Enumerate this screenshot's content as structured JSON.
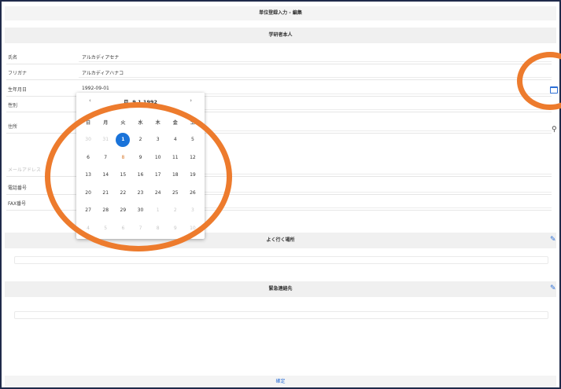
{
  "page": {
    "title": "単位登録入力 - 編集",
    "section_applicant": "学研者本人",
    "section_places": "よく行く場所",
    "section_contacts": "緊急連絡先",
    "footer_button": "確定"
  },
  "form": {
    "name_label": "氏名",
    "name_value": "アルカディアセナ",
    "kana_label": "フリガナ",
    "kana_value": "アルカディアハナコ",
    "birthday_label": "生年月日",
    "birthday_value": "1992-09-01",
    "gender_label": "性別",
    "address_label": "住所",
    "email_label": "メールアドレス",
    "phone_label": "電話番号",
    "fax_label": "FAX番号"
  },
  "calendar": {
    "header": "月, 9 1 1992",
    "prev": "‹",
    "next": "›",
    "weekdays": [
      "日",
      "月",
      "火",
      "水",
      "木",
      "金",
      "土"
    ],
    "weeks": [
      [
        "30",
        "31",
        "1",
        "2",
        "3",
        "4",
        "5"
      ],
      [
        "6",
        "7",
        "8",
        "9",
        "10",
        "11",
        "12"
      ],
      [
        "13",
        "14",
        "15",
        "16",
        "17",
        "18",
        "19"
      ],
      [
        "20",
        "21",
        "22",
        "23",
        "24",
        "25",
        "26"
      ],
      [
        "27",
        "28",
        "29",
        "30",
        "1",
        "2",
        "3"
      ],
      [
        "4",
        "5",
        "6",
        "7",
        "8",
        "9",
        "10"
      ]
    ],
    "selected_day": "1"
  },
  "colors": {
    "accent": "#1a73d9",
    "annotation": "#ed7b2d",
    "frame": "#1f2a4a"
  },
  "icons": {
    "calendar": "calendar-icon",
    "pin": "map-pin-icon",
    "edit": "pencil-icon"
  }
}
